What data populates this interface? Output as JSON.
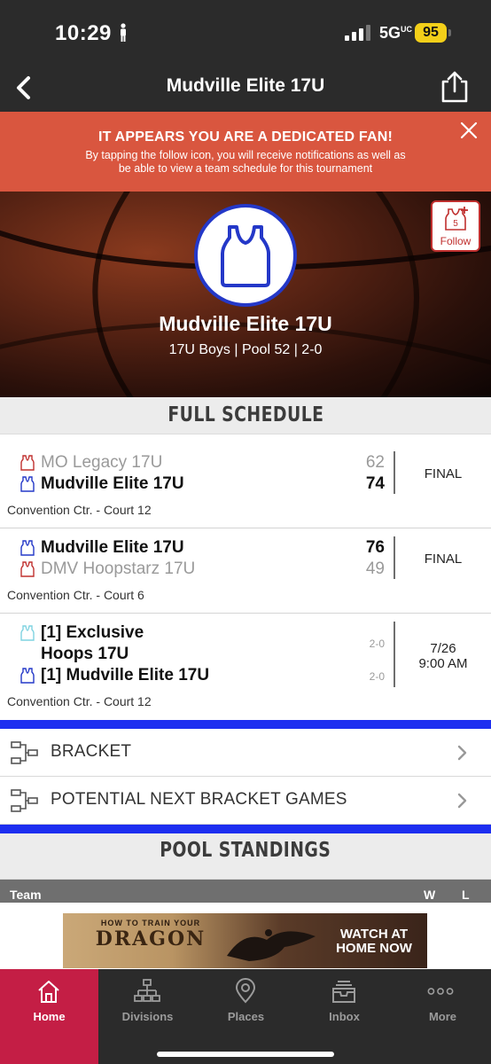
{
  "status_bar": {
    "time": "10:29",
    "network": "5G",
    "network_suffix": "UC",
    "battery": "95"
  },
  "header": {
    "title": "Mudville Elite 17U",
    "back_icon": "chevron-left-icon",
    "share_icon": "share-icon"
  },
  "banner": {
    "title": "IT APPEARS YOU ARE A DEDICATED FAN!",
    "text": "By tapping the follow icon, you will receive notifications as well as be able to view a team schedule for this tournament",
    "close_icon": "close-icon"
  },
  "hero": {
    "team_name": "Mudville Elite 17U",
    "subtitle": "17U Boys | Pool 52 | 2-0",
    "follow_label": "Follow",
    "follow_badge": "5"
  },
  "schedule": {
    "title": "FULL SCHEDULE",
    "games": [
      {
        "team1": "MO Legacy 17U",
        "score1": "62",
        "team2": "Mudville Elite 17U",
        "score2": "74",
        "status": "FINAL",
        "venue": "Convention Ctr. - Court 12"
      },
      {
        "team1": "Mudville Elite 17U",
        "score1": "76",
        "team2": "DMV Hoopstarz 17U",
        "score2": "49",
        "status": "FINAL",
        "venue": "Convention Ctr. - Court 6"
      },
      {
        "team1_line1": "[1] Exclusive",
        "team1_line2": "Hoops 17U",
        "record1": "2-0",
        "team2": "[1] Mudville Elite 17U",
        "record2": "2-0",
        "date": "7/26",
        "time": "9:00 AM",
        "venue": "Convention Ctr. - Court 12"
      }
    ]
  },
  "links": [
    {
      "label": "BRACKET"
    },
    {
      "label": "POTENTIAL NEXT BRACKET GAMES"
    }
  ],
  "standings": {
    "title": "POOL STANDINGS",
    "columns": {
      "team": "Team",
      "w": "W",
      "l": "L"
    }
  },
  "ad": {
    "small_text": "HOW TO TRAIN YOUR",
    "big_text": "DRAGON",
    "cta_line1": "WATCH AT",
    "cta_line2": "HOME NOW"
  },
  "tabs": [
    {
      "label": "Home",
      "icon": "home-icon",
      "active": true
    },
    {
      "label": "Divisions",
      "icon": "divisions-icon"
    },
    {
      "label": "Places",
      "icon": "location-pin-icon"
    },
    {
      "label": "Inbox",
      "icon": "inbox-icon"
    },
    {
      "label": "More",
      "icon": "more-icon"
    }
  ],
  "colors": {
    "header_bg": "#2b2b2b",
    "banner_bg": "#d9563f",
    "accent_red": "#c41e45",
    "accent_blue": "#1d2ef0",
    "team_blue": "#2438c8"
  }
}
